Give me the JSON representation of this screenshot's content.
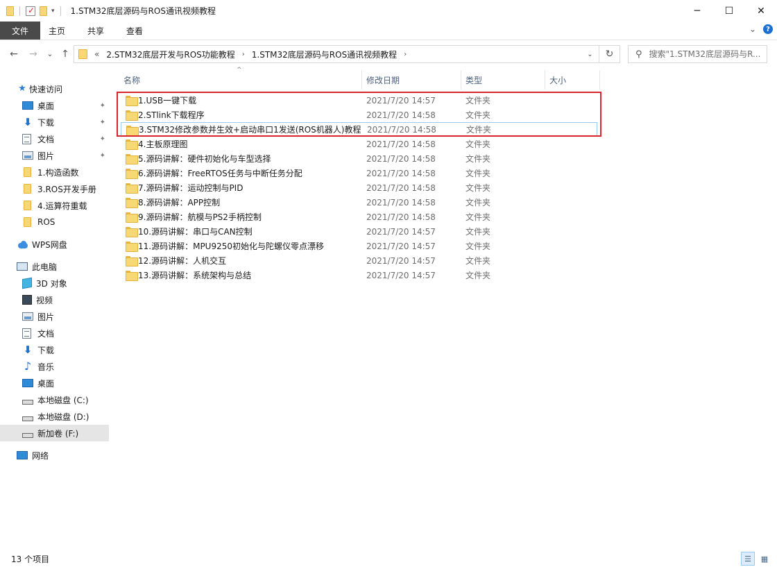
{
  "window": {
    "title": "1.STM32底层源码与ROS通讯视频教程",
    "minimize_glyph": "─",
    "maximize_glyph": "☐",
    "close_glyph": "✕"
  },
  "ribbon": {
    "tabs": [
      "文件",
      "主页",
      "共享",
      "查看"
    ],
    "expand_glyph": "⌄",
    "help_glyph": "?"
  },
  "nav": {
    "back_glyph": "←",
    "forward_glyph": "→",
    "recent_glyph": "⌄",
    "up_glyph": "↑",
    "overflow_glyph": "«",
    "breadcrumbs": [
      "2.STM32底层开发与ROS功能教程",
      "1.STM32底层源码与ROS通讯视频教程"
    ],
    "crumb_sep": "›",
    "dropdown_glyph": "⌄",
    "refresh_glyph": "↻"
  },
  "search": {
    "placeholder": "搜索\"1.STM32底层源码与R...",
    "icon_glyph": "⚲"
  },
  "sidebar": {
    "quick_access": "快速访问",
    "pinned": [
      {
        "label": "桌面",
        "icon": "desktop-icon"
      },
      {
        "label": "下载",
        "icon": "download-icon"
      },
      {
        "label": "文档",
        "icon": "document-icon"
      },
      {
        "label": "图片",
        "icon": "picture-icon"
      }
    ],
    "pin_glyph": "📌",
    "recent_folders": [
      "1.构造函数",
      "3.ROS开发手册",
      "4.运算符重载",
      "ROS"
    ],
    "wps_cloud": "WPS网盘",
    "this_pc": "此电脑",
    "pc_items": [
      {
        "label": "3D 对象",
        "icon": "cube-icon"
      },
      {
        "label": "视频",
        "icon": "video-icon"
      },
      {
        "label": "图片",
        "icon": "picture-icon"
      },
      {
        "label": "文档",
        "icon": "document-icon"
      },
      {
        "label": "下载",
        "icon": "download-icon"
      },
      {
        "label": "音乐",
        "icon": "music-icon"
      },
      {
        "label": "桌面",
        "icon": "desktop-icon"
      },
      {
        "label": "本地磁盘 (C:)",
        "icon": "drive-icon"
      },
      {
        "label": "本地磁盘 (D:)",
        "icon": "drive-icon"
      },
      {
        "label": "新加卷 (F:)",
        "icon": "drive-icon"
      }
    ],
    "network": "网络"
  },
  "columns": {
    "name": "名称",
    "date": "修改日期",
    "type": "类型",
    "size": "大小",
    "sort_glyph": "^"
  },
  "files": [
    {
      "name": "1.USB一键下载",
      "date": "2021/7/20 14:57",
      "type": "文件夹"
    },
    {
      "name": "2.STlink下载程序",
      "date": "2021/7/20 14:58",
      "type": "文件夹"
    },
    {
      "name": "3.STM32修改参数并生效+启动串口1发送(ROS机器人)教程",
      "date": "2021/7/20 14:58",
      "type": "文件夹"
    },
    {
      "name": "4.主板原理图",
      "date": "2021/7/20 14:58",
      "type": "文件夹"
    },
    {
      "name": "5.源码讲解：硬件初始化与车型选择",
      "date": "2021/7/20 14:58",
      "type": "文件夹"
    },
    {
      "name": "6.源码讲解：FreeRTOS任务与中断任务分配",
      "date": "2021/7/20 14:58",
      "type": "文件夹"
    },
    {
      "name": "7.源码讲解：运动控制与PID",
      "date": "2021/7/20 14:58",
      "type": "文件夹"
    },
    {
      "name": "8.源码讲解：APP控制",
      "date": "2021/7/20 14:58",
      "type": "文件夹"
    },
    {
      "name": "9.源码讲解：航模与PS2手柄控制",
      "date": "2021/7/20 14:58",
      "type": "文件夹"
    },
    {
      "name": "10.源码讲解：串口与CAN控制",
      "date": "2021/7/20 14:57",
      "type": "文件夹"
    },
    {
      "name": "11.源码讲解：MPU9250初始化与陀螺仪零点漂移",
      "date": "2021/7/20 14:57",
      "type": "文件夹"
    },
    {
      "name": "12.源码讲解：人机交互",
      "date": "2021/7/20 14:57",
      "type": "文件夹"
    },
    {
      "name": "13.源码讲解：系统架构与总结",
      "date": "2021/7/20 14:57",
      "type": "文件夹"
    }
  ],
  "status": {
    "item_count": "13 个项目"
  },
  "colors": {
    "highlight_box": "#d9242b",
    "accent": "#1a6fd1",
    "folder": "#f8d775"
  }
}
